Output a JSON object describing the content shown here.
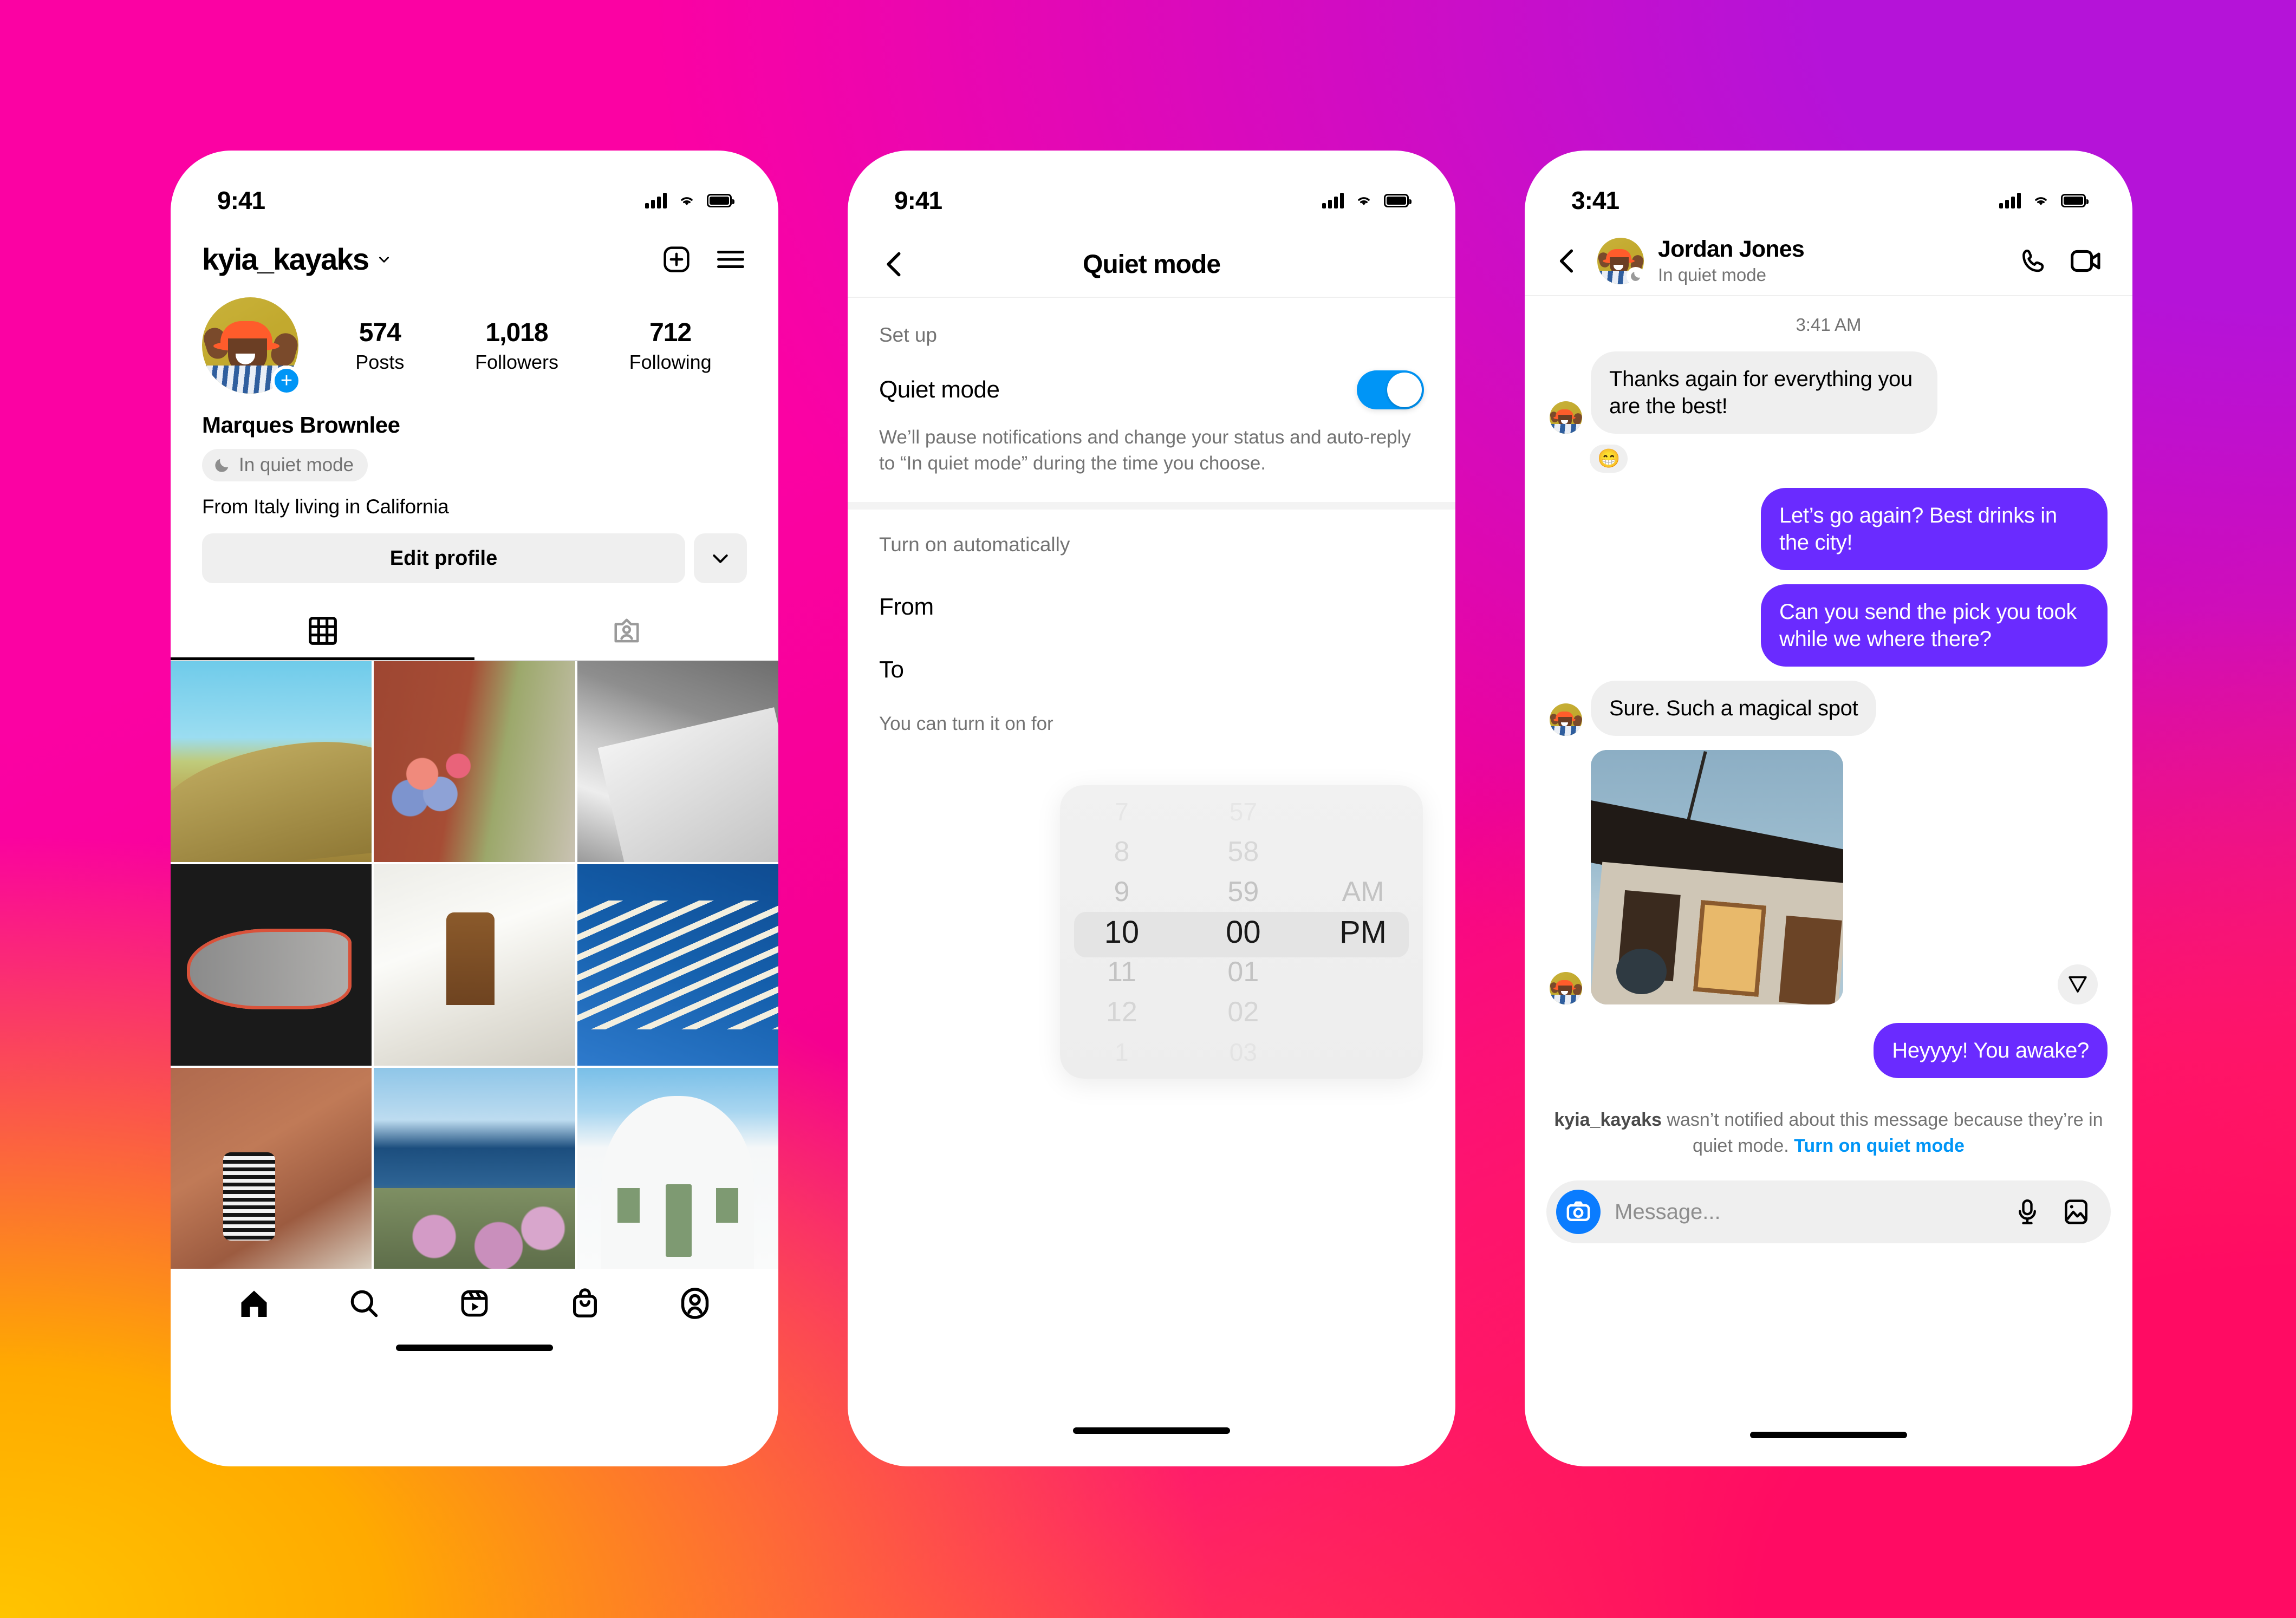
{
  "theme": {
    "accent_blue": "#0095F6",
    "bubble_purple": "#6A2BFF",
    "bubble_grey": "#EFEFEF",
    "text_secondary": "#737373"
  },
  "phone_profile": {
    "status_bar": {
      "time": "9:41"
    },
    "header": {
      "username": "kyia_kayaks",
      "chevron_icon": "chevron-down-icon",
      "add_icon": "new-post-icon",
      "menu_icon": "hamburger-menu-icon"
    },
    "avatar": {
      "add_story_icon": "plus-icon"
    },
    "stats": [
      {
        "value": "574",
        "label": "Posts"
      },
      {
        "value": "1,018",
        "label": "Followers"
      },
      {
        "value": "712",
        "label": "Following"
      }
    ],
    "bio": {
      "display_name": "Marques Brownlee",
      "status_chip": "In quiet mode",
      "status_icon": "moon-icon",
      "description": "From Italy living in California"
    },
    "buttons": {
      "edit_profile": "Edit profile",
      "more_icon": "chevron-down-icon"
    },
    "tabs": [
      {
        "name": "grid-tab",
        "icon": "grid-icon",
        "active": true
      },
      {
        "name": "tagged-tab",
        "icon": "tagged-icon",
        "active": false
      }
    ],
    "grid_photos": [
      "hillside-landscape",
      "brick-street-flowers",
      "bw-building-cornice",
      "charcoal-dinosaur-art",
      "white-house-doorway",
      "blue-sky-pergola",
      "venice-bridge-walker",
      "coastal-cliff-blossom",
      "white-domed-house"
    ],
    "bottom_nav": [
      {
        "name": "home-tab",
        "icon": "home-icon"
      },
      {
        "name": "search-tab",
        "icon": "search-icon"
      },
      {
        "name": "reels-tab",
        "icon": "reels-icon"
      },
      {
        "name": "shop-tab",
        "icon": "shop-bag-icon"
      },
      {
        "name": "profile-tab",
        "icon": "profile-icon"
      }
    ]
  },
  "phone_settings": {
    "status_bar": {
      "time": "9:41"
    },
    "nav": {
      "back_icon": "back-chevron-icon",
      "title": "Quiet mode"
    },
    "section_setup": {
      "label": "Set up",
      "toggle_label": "Quiet mode",
      "toggle_on": true,
      "note": "We’ll pause notifications and change your status and auto-reply to “In quiet mode” during the time you choose."
    },
    "section_auto": {
      "label": "Turn on automatically",
      "from_label": "From",
      "to_label": "To",
      "footer": "You can turn it on for"
    },
    "time_picker": {
      "hours": [
        "7",
        "8",
        "9",
        "10",
        "11",
        "12",
        "1"
      ],
      "minutes": [
        "57",
        "58",
        "59",
        "00",
        "01",
        "02",
        "03"
      ],
      "periods": [
        "AM",
        "PM"
      ],
      "selected_hour": "10",
      "selected_minute": "00",
      "selected_period": "PM"
    }
  },
  "phone_chat": {
    "status_bar": {
      "time": "3:41"
    },
    "nav": {
      "back_icon": "back-chevron-icon",
      "contact_name": "Jordan Jones",
      "contact_status": "In quiet mode",
      "status_icon": "moon-icon",
      "call_icon": "phone-call-icon",
      "video_icon": "video-call-icon"
    },
    "timestamp": "3:41 AM",
    "messages": [
      {
        "side": "in",
        "text": "Thanks again for everything you are the best!",
        "reaction": "😁",
        "avatar": true
      },
      {
        "side": "out",
        "text": "Let’s go again? Best drinks in the city!"
      },
      {
        "side": "out",
        "text": "Can you send the pick you took while we where there?"
      },
      {
        "side": "in",
        "text": "Sure. Such a magical spot",
        "avatar": true
      },
      {
        "side": "in",
        "type": "photo",
        "alt": "building-corner-at-dusk",
        "avatar": true
      },
      {
        "side": "out",
        "text": "Heyyyy! You awake?"
      }
    ],
    "send_icon": "send-arrow-icon",
    "notice": {
      "username": "kyia_kayaks",
      "text": " wasn’t notified about this message because they’re in quiet mode. ",
      "link": "Turn on quiet mode"
    },
    "composer": {
      "camera_icon": "camera-icon",
      "placeholder": "Message...",
      "value": "",
      "mic_icon": "microphone-icon",
      "gallery_icon": "gallery-icon"
    }
  }
}
